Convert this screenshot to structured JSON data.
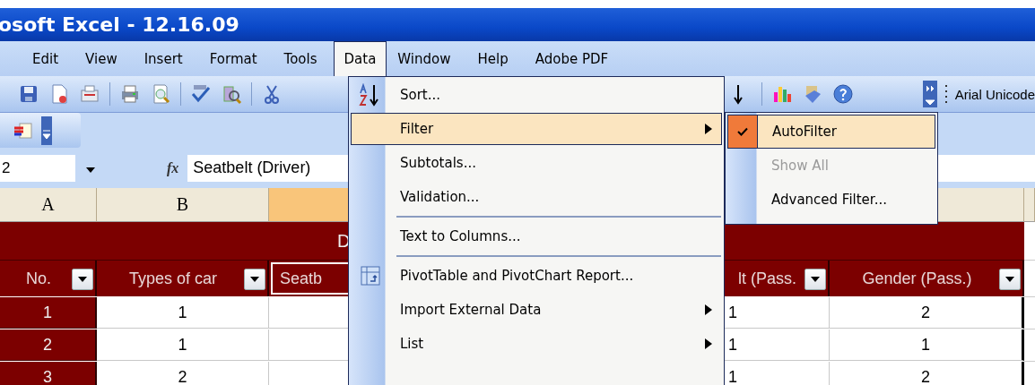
{
  "window": {
    "title": "osoft Excel - 12.16.09"
  },
  "menu_bar": [
    {
      "label": "Edit",
      "selected": false
    },
    {
      "label": "View",
      "selected": false
    },
    {
      "label": "Insert",
      "selected": false
    },
    {
      "label": "Format",
      "selected": false
    },
    {
      "label": "Tools",
      "selected": false
    },
    {
      "label": "Data",
      "selected": true
    },
    {
      "label": "Window",
      "selected": false
    },
    {
      "label": "Help",
      "selected": false
    },
    {
      "label": "Adobe PDF",
      "selected": false
    }
  ],
  "toolbar": {
    "font": "Arial Unicode"
  },
  "formula_bar": {
    "name_box": "2",
    "fx": "fx",
    "formula": "Seatbelt (Driver)"
  },
  "column_headers": [
    {
      "label": "A",
      "selected": false
    },
    {
      "label": "B",
      "selected": false
    },
    {
      "selected": true
    }
  ],
  "sheet": {
    "title": "D",
    "header": [
      {
        "label": "No.",
        "filter": true
      },
      {
        "label": "Types of car",
        "filter": true
      },
      {
        "label": "Seatb"
      },
      {
        "label": "lt (Pass.",
        "filter": true
      },
      {
        "label": "Gender (Pass.)",
        "filter": true
      }
    ],
    "rows": [
      {
        "no": "1",
        "car_type": "1",
        "column_4": "1",
        "gender_pass": "2"
      },
      {
        "no": "2",
        "car_type": "1",
        "column_4": "1",
        "gender_pass": "1"
      },
      {
        "no": "3",
        "car_type": "2",
        "column_4": "1",
        "gender_pass": "2"
      }
    ]
  },
  "data_menu": [
    {
      "kind": "item",
      "label": "Sort...",
      "selected": false,
      "submenu": false
    },
    {
      "kind": "item",
      "label": "Filter",
      "selected": true,
      "submenu": true
    },
    {
      "kind": "item",
      "label": "Subtotals...",
      "selected": false,
      "submenu": false
    },
    {
      "kind": "item",
      "label": "Validation...",
      "selected": false,
      "submenu": false
    },
    {
      "kind": "separator"
    },
    {
      "kind": "item",
      "label": "Text to Columns...",
      "selected": false,
      "submenu": false
    },
    {
      "kind": "separator"
    },
    {
      "kind": "item",
      "label": "PivotTable and PivotChart Report...",
      "selected": false,
      "submenu": false
    },
    {
      "kind": "item",
      "label": "Import External Data",
      "selected": false,
      "submenu": true
    },
    {
      "kind": "item",
      "label": "List",
      "selected": false,
      "submenu": true
    }
  ],
  "filter_submenu": [
    {
      "label": "AutoFilter",
      "checked": true,
      "selected": true,
      "disabled": false
    },
    {
      "label": "Show All",
      "checked": false,
      "selected": false,
      "disabled": true
    },
    {
      "label": "Advanced Filter...",
      "checked": false,
      "selected": false,
      "disabled": false
    }
  ]
}
